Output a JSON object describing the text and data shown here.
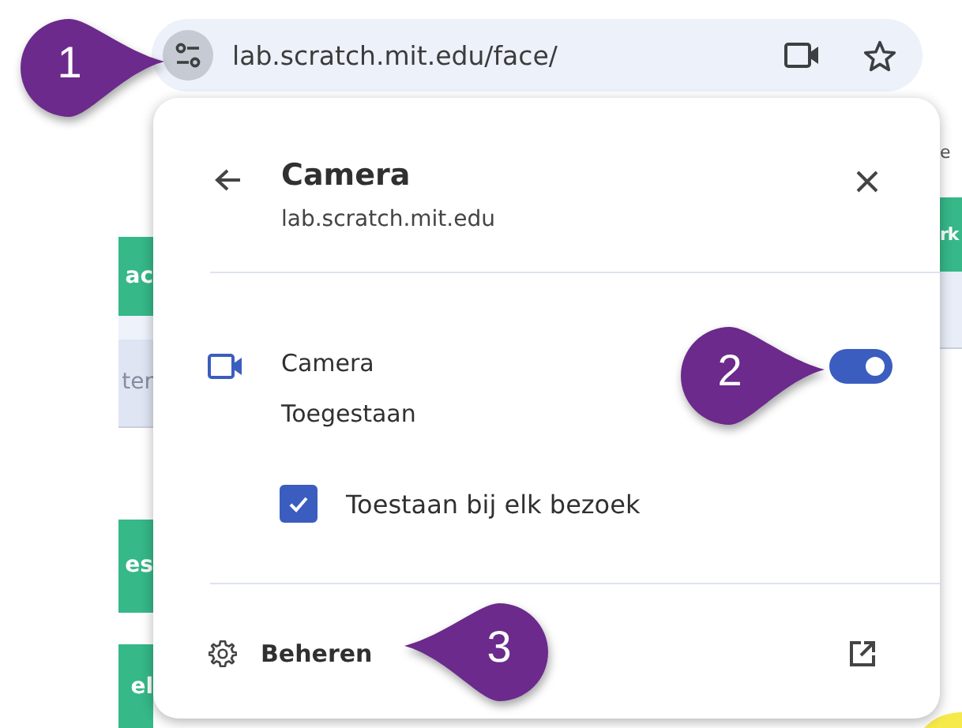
{
  "address_bar": {
    "url": "lab.scratch.mit.edu/face/"
  },
  "background_page": {
    "left_fragments": [
      {
        "text": "ac",
        "kind": "green"
      },
      {
        "text": "ter",
        "kind": "field"
      },
      {
        "text": "es",
        "kind": "green"
      },
      {
        "text": "el",
        "kind": "green"
      }
    ],
    "right_fragments": [
      {
        "text": "e",
        "kind": "plain"
      },
      {
        "text": "rk",
        "kind": "green"
      }
    ]
  },
  "popup": {
    "title": "Camera",
    "subtitle": "lab.scratch.mit.edu",
    "permission": {
      "name": "Camera",
      "status": "Toegestaan",
      "on": true
    },
    "remember": {
      "label": "Toestaan bij elk bezoek",
      "checked": true
    },
    "manage": {
      "label": "Beheren"
    }
  },
  "callouts": [
    {
      "number": "1",
      "kind": "right"
    },
    {
      "number": "2",
      "kind": "right"
    },
    {
      "number": "3",
      "kind": "left"
    }
  ]
}
